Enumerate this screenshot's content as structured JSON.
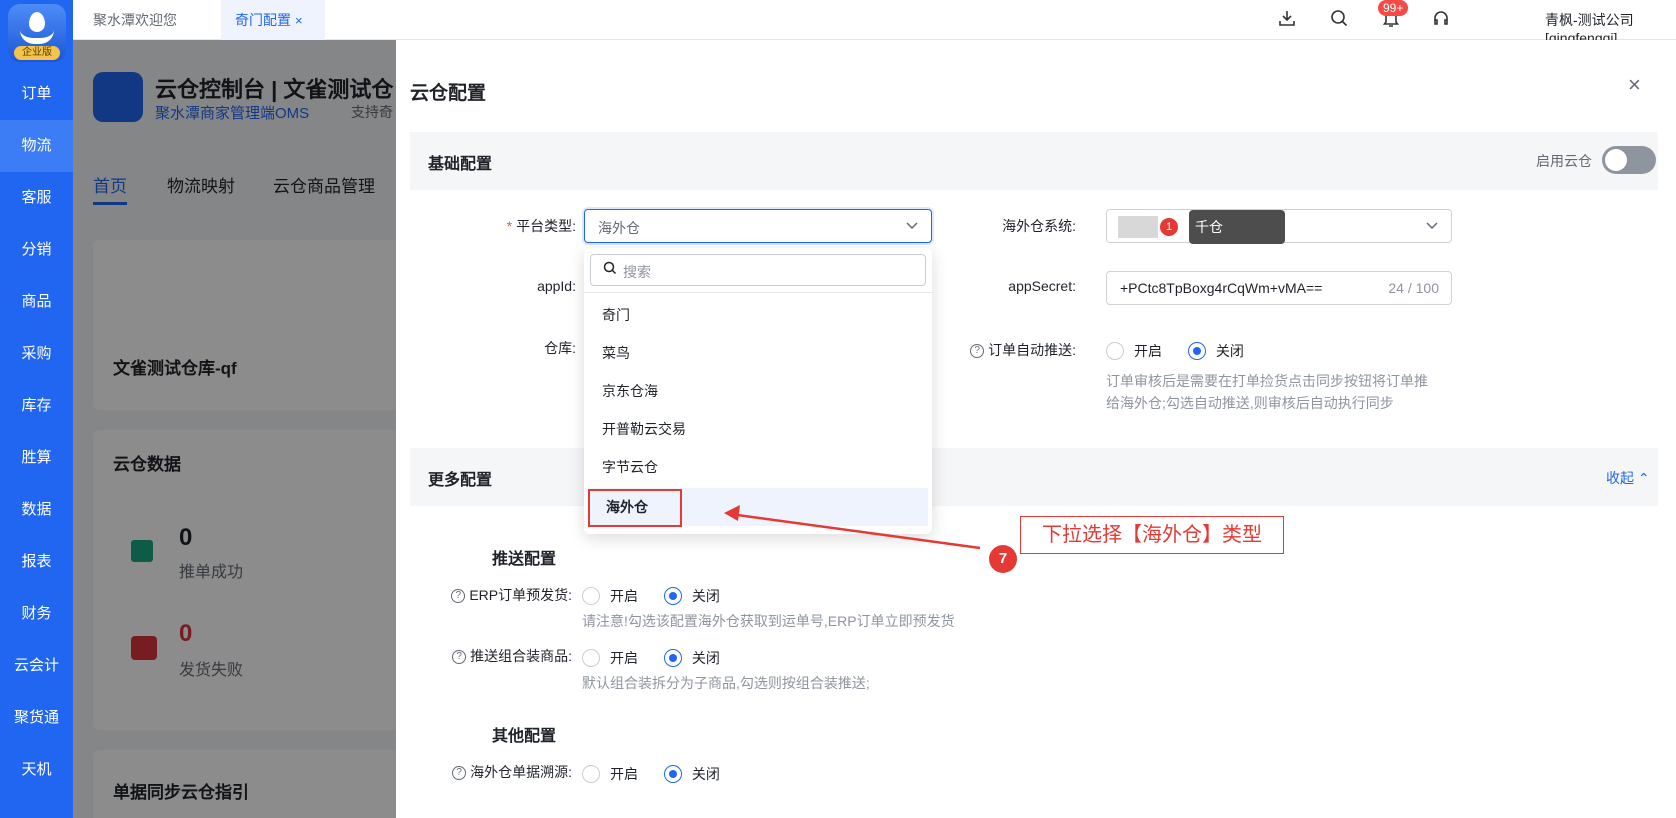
{
  "sidebar": {
    "logo_tag": "企业版",
    "items": [
      {
        "label": "订单",
        "active": false
      },
      {
        "label": "物流",
        "active": true
      },
      {
        "label": "客服",
        "active": false
      },
      {
        "label": "分销",
        "active": false
      },
      {
        "label": "商品",
        "active": false
      },
      {
        "label": "采购",
        "active": false
      },
      {
        "label": "库存",
        "active": false
      },
      {
        "label": "胜算",
        "active": false
      },
      {
        "label": "数据",
        "active": false
      },
      {
        "label": "报表",
        "active": false
      },
      {
        "label": "财务",
        "active": false
      },
      {
        "label": "云会计",
        "active": false
      },
      {
        "label": "聚货通",
        "active": false
      },
      {
        "label": "天机",
        "active": false
      }
    ]
  },
  "topbar": {
    "tabs": [
      {
        "label": "聚水潭欢迎您",
        "active": false
      },
      {
        "label": "奇门配置",
        "active": true,
        "close": "×"
      }
    ],
    "badge": "99+",
    "user": "青枫-测试公司[qingfengqi]"
  },
  "background": {
    "title": "云仓控制台 | 文雀测试仓",
    "subtitle": "聚水潭商家管理端OMS",
    "subtitle_suffix": "支持奇",
    "tabs": [
      "首页",
      "物流映射",
      "云仓商品管理"
    ],
    "warehouse": "文雀测试仓库-qf",
    "data_title": "云仓数据",
    "success_count": "0",
    "success_label": "推单成功",
    "fail_count": "0",
    "fail_label": "发货失败",
    "guide_title": "单据同步云仓指引"
  },
  "drawer": {
    "title": "云仓配置",
    "close": "×",
    "basic": {
      "header": "基础配置",
      "enable_label": "启用云仓",
      "platform_label": "平台类型:",
      "platform_value": "海外仓",
      "overseas_label": "海外仓系统:",
      "overseas_tip": "千仓",
      "overseas_tip_num": "1",
      "appid_label": "appId:",
      "appsecret_label": "appSecret:",
      "appsecret_value": "+PCtc8TpBoxg4rCqWm+vMA==",
      "appsecret_counter": "24 / 100",
      "warehouse_label": "仓库:",
      "auto_push_label": "订单自动推送:",
      "on": "开启",
      "off": "关闭",
      "auto_push_hint_1": "订单审核后是需要在打单捡货点击同步按钮将订单推",
      "auto_push_hint_2": "给海外仓;勾选自动推送,则审核后自动执行同步"
    },
    "more": {
      "header": "更多配置",
      "collapse": "收起",
      "push_header": "推送配置",
      "erp_label": "ERP订单预发货:",
      "erp_hint": "请注意!勾选该配置海外仓获取到运单号,ERP订单立即预发货",
      "combo_label": "推送组合装商品:",
      "combo_hint": "默认组合装拆分为子商品,勾选则按组合装推送;",
      "other_header": "其他配置",
      "trace_label": "海外仓单据溯源:"
    }
  },
  "dropdown": {
    "search_placeholder": "搜索",
    "options": [
      "奇门",
      "菜鸟",
      "京东仓海",
      "开普勒云交易",
      "字节云仓",
      "海外仓"
    ],
    "selected": "海外仓"
  },
  "annotation": {
    "text": "下拉选择【海外仓】类型",
    "step": "7"
  },
  "colors": {
    "primary": "#2166f0",
    "annotation": "#e53935"
  }
}
